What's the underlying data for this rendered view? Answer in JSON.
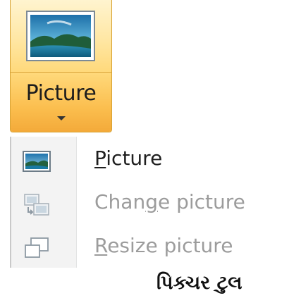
{
  "ribbon": {
    "button_label": "Picture",
    "large_icon": "landscape-picture-icon",
    "dropdown_icon": "triangle-down-icon",
    "accent_color": "#f9b847",
    "hover_color": "#ffe7a4"
  },
  "menu": {
    "items": [
      {
        "label": "Picture",
        "access_key": "P",
        "label_rest": "icture",
        "icon": "picture-icon",
        "enabled": true
      },
      {
        "label": "Change picture",
        "label_before": "Chan",
        "access_key": "g",
        "label_after": "e picture",
        "icon": "change-picture-icon",
        "enabled": false
      },
      {
        "label": "Resize picture",
        "access_key": "R",
        "label_rest": "esize picture",
        "icon": "resize-picture-icon",
        "enabled": false
      }
    ]
  },
  "caption": {
    "text": "પિક્ચર ટુલ"
  }
}
